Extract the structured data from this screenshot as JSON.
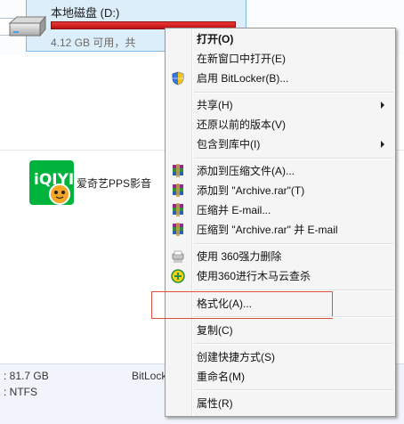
{
  "drive": {
    "name": "本地磁盘 (D:)",
    "free_text": "4.12 GB 可用，共",
    "usage_fraction": 0.97,
    "bar_color": "#d81a1a"
  },
  "apps": [
    {
      "label": "爱奇艺PPS影音",
      "icon": "iqiyi-app-icon"
    }
  ],
  "status": {
    "line1": ": 81.7 GB",
    "line2": ": NTFS",
    "line3": "BitLock"
  },
  "menu": {
    "open": "打开(O)",
    "open_new_window": "在新窗口中打开(E)",
    "bitlocker": "启用 BitLocker(B)...",
    "share": "共享(H)",
    "restore_versions": "还原以前的版本(V)",
    "include_library": "包含到库中(I)",
    "add_to_archive": "添加到压缩文件(A)...",
    "add_to_archive_rar": "添加到 \"Archive.rar\"(T)",
    "compress_email": "压缩并 E-mail...",
    "compress_rar_email": "压缩到 \"Archive.rar\" 并 E-mail",
    "force_delete_360": "使用 360强力删除",
    "scan_360": "使用360进行木马云查杀",
    "format": "格式化(A)...",
    "copy": "复制(C)",
    "create_shortcut": "创建快捷方式(S)",
    "rename": "重命名(M)",
    "properties": "属性(R)"
  },
  "colors": {
    "highlight_box": "#e0503c",
    "menu_bg": "#f5f5f5"
  }
}
